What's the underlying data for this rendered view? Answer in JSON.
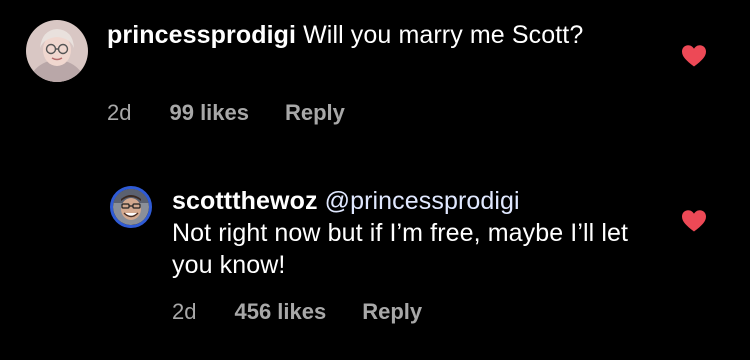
{
  "colors": {
    "background": "#000000",
    "text": "#ffffff",
    "meta": "#a8a8a8",
    "heart": "#ed4956",
    "reply_avatar_ring": "#2f5bd6"
  },
  "comments": [
    {
      "username": "princessprodigi",
      "text": "Will you marry me Scott?",
      "time": "2d",
      "likes": "99 likes",
      "reply_label": "Reply",
      "liked_icon": "heart-filled-icon"
    }
  ],
  "replies": [
    {
      "username": "scottthewoz",
      "mention": "@princessprodigi",
      "text": "Not right now but if I’m free, maybe I’ll let you know!",
      "time": "2d",
      "likes": "456 likes",
      "reply_label": "Reply",
      "liked_icon": "heart-filled-icon"
    }
  ]
}
